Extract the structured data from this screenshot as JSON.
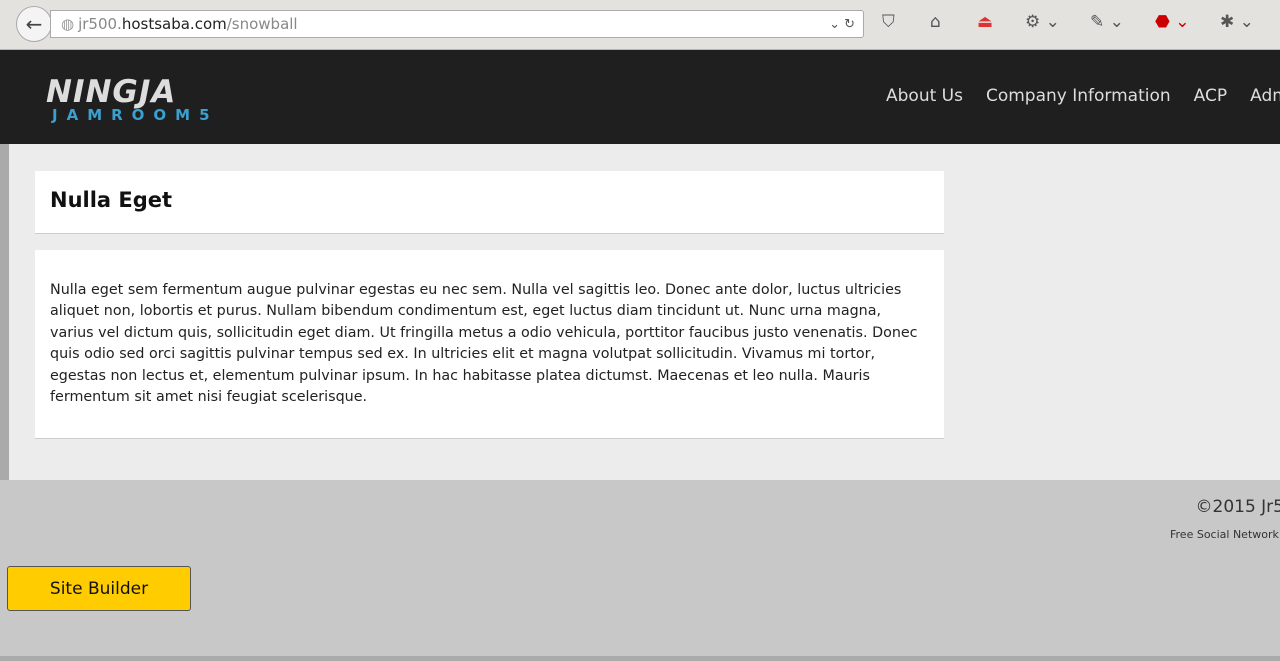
{
  "browser": {
    "url_prefix": "jr500.",
    "url_domain": "hostsaba.com",
    "url_path": "/snowball"
  },
  "header": {
    "logo_main": "NINGJA",
    "logo_sub": "JAMROOM5",
    "nav": [
      "About Us",
      "Company Information",
      "ACP",
      "Adm"
    ]
  },
  "content": {
    "title": "Nulla Eget",
    "body": "Nulla eget sem fermentum augue pulvinar egestas eu nec sem. Nulla vel sagittis leo. Donec ante dolor, luctus ultricies aliquet non, lobortis et purus. Nullam bibendum condimentum est, eget luctus diam tincidunt ut. Nunc urna magna, varius vel dictum quis, sollicitudin eget diam. Ut fringilla metus a odio vehicula, porttitor faucibus justo venenatis. Donec quis odio sed orci sagittis pulvinar tempus sed ex. In ultricies elit et magna volutpat sollicitudin. Vivamus mi tortor, egestas non lectus et, elementum pulvinar ipsum. In hac habitasse platea dictumst. Maecenas et leo nulla. Mauris fermentum sit amet nisi feugiat scelerisque."
  },
  "footer": {
    "copyright": "©2015 Jr5",
    "tagline": "Free Social Network S"
  },
  "site_builder_label": "Site Builder"
}
